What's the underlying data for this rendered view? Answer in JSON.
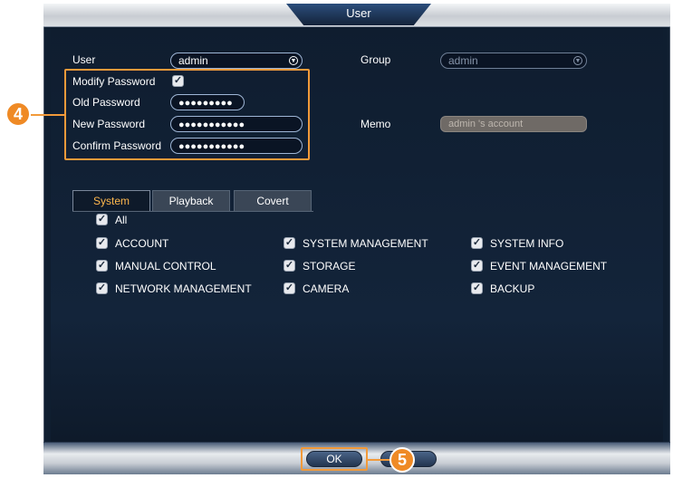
{
  "window": {
    "title": "User"
  },
  "form": {
    "user_label": "User",
    "user_value": "admin",
    "group_label": "Group",
    "group_value": "admin",
    "modify_password_label": "Modify Password",
    "modify_password_checked": true,
    "old_password_label": "Old Password",
    "old_password_value": "●●●●●●●●●",
    "new_password_label": "New Password",
    "new_password_value": "●●●●●●●●●●●",
    "confirm_password_label": "Confirm Password",
    "confirm_password_value": "●●●●●●●●●●●",
    "memo_label": "Memo",
    "memo_value": "admin 's account"
  },
  "tabs": [
    {
      "label": "System",
      "active": true
    },
    {
      "label": "Playback",
      "active": false
    },
    {
      "label": "Covert",
      "active": false
    }
  ],
  "permissions": {
    "all_label": "All",
    "items": [
      [
        "ACCOUNT",
        "SYSTEM MANAGEMENT",
        "SYSTEM INFO"
      ],
      [
        "MANUAL CONTROL",
        "STORAGE",
        "EVENT MANAGEMENT"
      ],
      [
        "NETWORK MANAGEMENT",
        "CAMERA",
        "BACKUP"
      ]
    ]
  },
  "buttons": {
    "ok": "OK"
  },
  "annotations": {
    "step_a": "4",
    "step_b": "5"
  },
  "colors": {
    "accent": "#f29a3a",
    "background": "#0f1e30",
    "active_tab": "#ffb84d"
  }
}
